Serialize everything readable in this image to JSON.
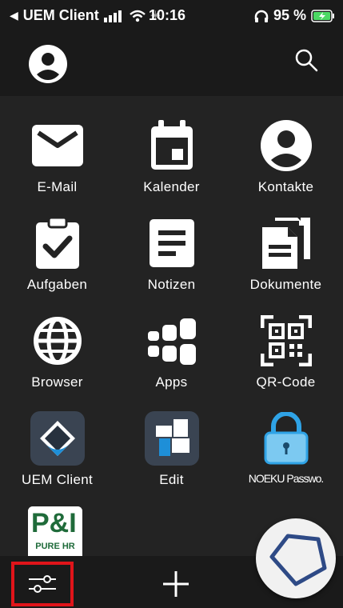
{
  "status": {
    "carrier": "UEM Client",
    "time": "10:16",
    "battery": "95 %"
  },
  "apps": [
    {
      "label": "E-Mail",
      "icon": "envelope-icon"
    },
    {
      "label": "Kalender",
      "icon": "calendar-icon"
    },
    {
      "label": "Kontakte",
      "icon": "contact-icon"
    },
    {
      "label": "Aufgaben",
      "icon": "clipboard-check-icon"
    },
    {
      "label": "Notizen",
      "icon": "notes-icon"
    },
    {
      "label": "Dokumente",
      "icon": "documents-icon"
    },
    {
      "label": "Browser",
      "icon": "globe-icon"
    },
    {
      "label": "Apps",
      "icon": "apps-icon"
    },
    {
      "label": "QR-Code",
      "icon": "qr-code-icon"
    },
    {
      "label": "UEM Client",
      "icon": "uem-client-app-icon"
    },
    {
      "label": "Edit",
      "icon": "edit-app-icon"
    },
    {
      "label": "NOEKU Passwo.",
      "icon": "padlock-app-icon"
    }
  ],
  "partial_app": {
    "icon": "pure-hr-app-icon",
    "logo_text": "P&I",
    "subtext": "PURE HR"
  },
  "colors": {
    "background": "#232323",
    "bars": "#1a1a1a",
    "highlight": "#e0141a",
    "battery_fill": "#4cd964"
  }
}
